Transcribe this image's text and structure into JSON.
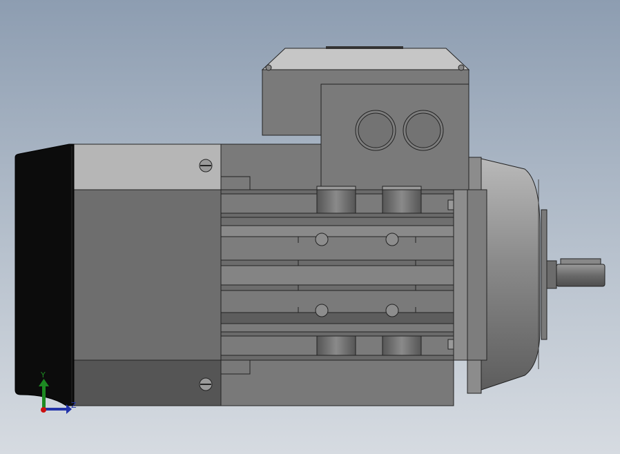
{
  "viewport": {
    "background_top": "#8d9db1",
    "background_bottom": "#d6dbe1"
  },
  "triad": {
    "y_label": "Y",
    "z_label": "Z",
    "y_color": "#1d8a22",
    "z_color": "#2233aa",
    "origin_color": "#cc1111"
  },
  "model": {
    "fan_cover_color": "#0c0c0c",
    "body_color": "#6e6e6e",
    "light_panel_color": "#b4b4b4",
    "flange_color": "#8a8a8a"
  }
}
